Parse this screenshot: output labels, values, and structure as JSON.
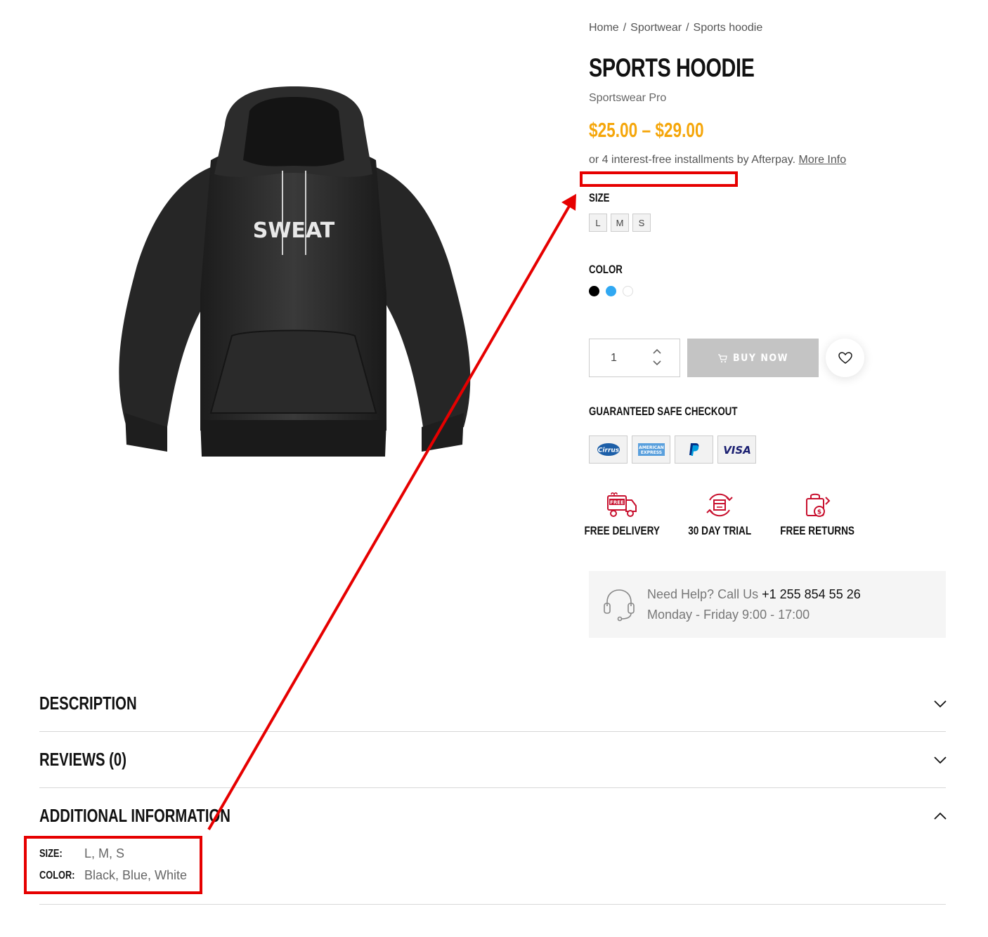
{
  "breadcrumb": {
    "home": "Home",
    "category": "Sportwear",
    "current": "Sports hoodie",
    "separator": "/"
  },
  "product": {
    "title": "SPORTS HOODIE",
    "brand": "Sportswear Pro",
    "price": "$25.00 – $29.00",
    "image_print": "SWEAT",
    "afterpay_text": "or 4 interest-free installments by Afterpay.",
    "afterpay_link": "More Info"
  },
  "options": {
    "size_label": "SIZE",
    "sizes": [
      "L",
      "M",
      "S"
    ],
    "color_label": "COLOR",
    "colors": [
      {
        "name": "black",
        "hex": "#000000"
      },
      {
        "name": "blue",
        "hex": "#30a8f2"
      },
      {
        "name": "white",
        "hex": "#ffffff"
      }
    ]
  },
  "cart": {
    "quantity": "1",
    "buy_label": "BUY NOW"
  },
  "checkout": {
    "label": "GUARANTEED SAFE CHECKOUT",
    "payment_methods": [
      "cirrus-icon",
      "american-express-icon",
      "paypal-icon",
      "visa-icon"
    ],
    "card_texts": {
      "cirrus": "Cirrus",
      "amex_line1": "AMERICAN",
      "amex_line2": "EXPRESS",
      "visa": "VISA"
    }
  },
  "features": {
    "delivery": "FREE DELIVERY",
    "delivery_badge": "FREE",
    "trial": "30 DAY TRIAL",
    "returns": "FREE RETURNS"
  },
  "help": {
    "line1_prefix": "Need Help? Call Us",
    "phone": "+1 255 854 55 26",
    "hours": "Monday - Friday 9:00 - 17:00"
  },
  "accordion": {
    "description": "DESCRIPTION",
    "reviews": "REVIEWS (0)",
    "additional": "ADDITIONAL INFORMATION"
  },
  "additional_info": {
    "size_label": "SIZE:",
    "size_value": "L, M, S",
    "color_label": "COLOR:",
    "color_value": "Black, Blue, White"
  },
  "colors": {
    "price": "#f5a60a",
    "annotation": "#e60000",
    "feature_icon": "#c8102e",
    "buy_button": "#c4c4c4"
  }
}
